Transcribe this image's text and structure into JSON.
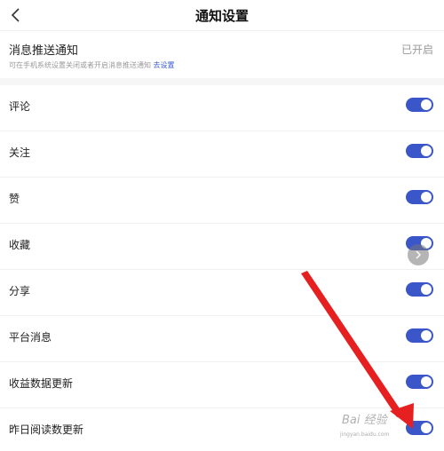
{
  "header": {
    "title": "通知设置",
    "back_icon": "chevron-left-icon"
  },
  "push": {
    "title": "消息推送通知",
    "status": "已开启",
    "hint": "可在手机系统设置关闭或者开启消息推送通知",
    "link": "去设置"
  },
  "items": [
    {
      "label": "评论",
      "on": true
    },
    {
      "label": "关注",
      "on": true
    },
    {
      "label": "赞",
      "on": true
    },
    {
      "label": "收藏",
      "on": true
    },
    {
      "label": "分享",
      "on": true
    },
    {
      "label": "平台消息",
      "on": true
    },
    {
      "label": "收益数据更新",
      "on": true
    },
    {
      "label": "昨日阅读数更新",
      "on": true
    }
  ],
  "colors": {
    "toggle_on": "#3a56c9",
    "arrow": "#e62020",
    "link": "#3b5bd9"
  },
  "watermark": {
    "text": "Bai 经验",
    "sub": "jingyan.baidu.com"
  }
}
